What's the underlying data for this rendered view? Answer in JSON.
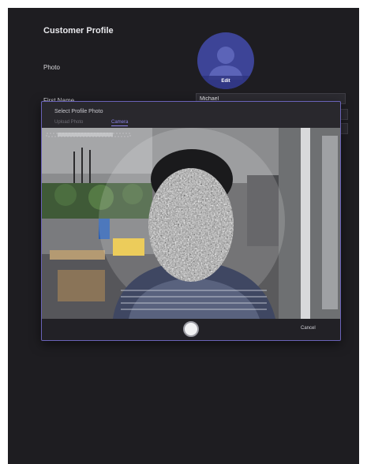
{
  "page": {
    "title": "Customer Profile",
    "photo_label": "Photo",
    "avatar_edit_label": "Edit",
    "first_name_label": "First Name",
    "first_name_value": "Michael"
  },
  "modal": {
    "title": "Select Profile Photo",
    "tabs": [
      {
        "label": "Upload Photo",
        "active": false
      },
      {
        "label": "Camera",
        "active": true
      }
    ],
    "cancel_label": "Cancel"
  },
  "colors": {
    "background": "#1e1d21",
    "accent": "#6a63b8",
    "avatar": "#3d4497",
    "active_tab": "#8b83e8"
  },
  "icons": {
    "avatar": "person-silhouette-icon",
    "capture": "shutter-icon"
  }
}
